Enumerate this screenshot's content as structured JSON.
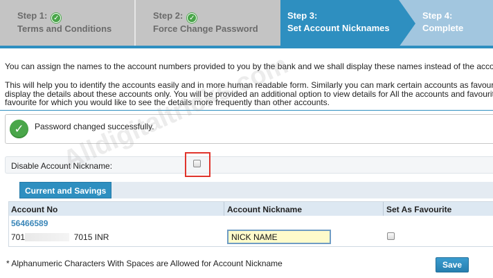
{
  "steps": [
    {
      "num": "Step 1:",
      "label": "Terms and Conditions",
      "done": true
    },
    {
      "num": "Step 2:",
      "label": "Force Change Password",
      "done": true
    },
    {
      "num": "Step 3:",
      "label": "Set Account Nicknames",
      "current": true
    },
    {
      "num": "Step 4:",
      "label": "Complete"
    }
  ],
  "intro": {
    "p1": "You can assign the names to the account numbers provided to you by the bank and we shall display these names instead of the acco",
    "p2_l1": "This will help you to identify the accounts easily and in more human readable form. Similarly you can mark certain accounts as favour",
    "p2_l2": "display the details about these accounts only. You will be provided an additional option to view details for All the accounts and favourit",
    "p2_l3": "favourite for which you would like to see the details more frequently than other accounts."
  },
  "success": {
    "message": "Password changed successfully.",
    "icon": "check-icon"
  },
  "disable_nickname": {
    "label": "Disable Account Nickname:",
    "checked": false
  },
  "section_tab": "Current and Savings",
  "table": {
    "headers": {
      "account_no": "Account No",
      "nickname": "Account Nickname",
      "favourite": "Set As Favourite"
    },
    "row": {
      "account_link": "56466589",
      "account_prefix": "701",
      "account_suffix": "7015 INR",
      "nickname_value": "NICK NAME",
      "favourite": false
    }
  },
  "footer": {
    "note": "* Alphanumeric Characters With Spaces are Allowed for Account Nickname",
    "save_label": "Save"
  },
  "watermark": "Alldigitaltricks.com",
  "colors": {
    "accent": "#2e8fc0",
    "success": "#4aa64a",
    "highlight": "#e0342c",
    "input_bg": "#fefbcb"
  }
}
